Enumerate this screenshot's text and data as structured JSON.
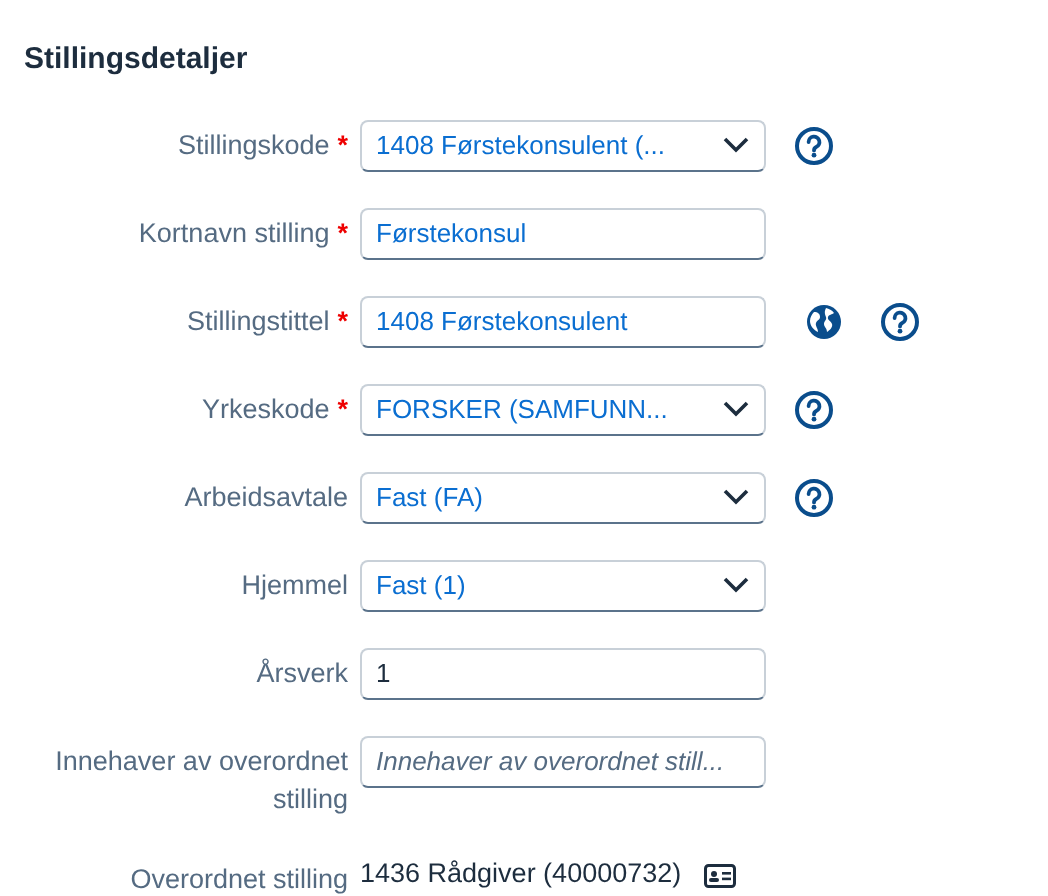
{
  "section": {
    "title": "Stillingsdetaljer"
  },
  "fields": [
    {
      "label": "Stillingskode",
      "required_mark": "*",
      "kind": "select",
      "value": "1408 Førstekonsulent (...",
      "help_button": true,
      "translation_button": false
    },
    {
      "label": "Kortnavn stilling",
      "required_mark": "*",
      "kind": "input",
      "value": "Førstekonsul",
      "help_button": false,
      "translation_button": false
    },
    {
      "label": "Stillingstittel",
      "required_mark": "*",
      "kind": "input",
      "value": "1408 Førstekonsulent",
      "help_button": true,
      "translation_button": true
    },
    {
      "label": "Yrkeskode",
      "required_mark": "*",
      "kind": "select",
      "value": "FORSKER (SAMFUNN...",
      "help_button": true,
      "translation_button": false
    },
    {
      "label": "Arbeidsavtale",
      "kind": "select",
      "value": "Fast (FA)",
      "help_button": true,
      "translation_button": false
    },
    {
      "label": "Hjemmel",
      "kind": "select",
      "value": "Fast (1)",
      "help_button": false,
      "translation_button": false
    },
    {
      "label": "Årsverk",
      "kind": "number",
      "value": "1",
      "help_button": false,
      "translation_button": false
    },
    {
      "label": "Innehaver av overordnet stilling",
      "kind": "input",
      "placeholder": "Innehaver av overordnet still...",
      "help_button": false,
      "translation_button": false
    },
    {
      "label": "Overordnet stilling",
      "kind": "readonly",
      "value": "1436 Rådgiver (40000732)",
      "help_button": false,
      "translation_button": false,
      "details_button": true
    }
  ]
}
